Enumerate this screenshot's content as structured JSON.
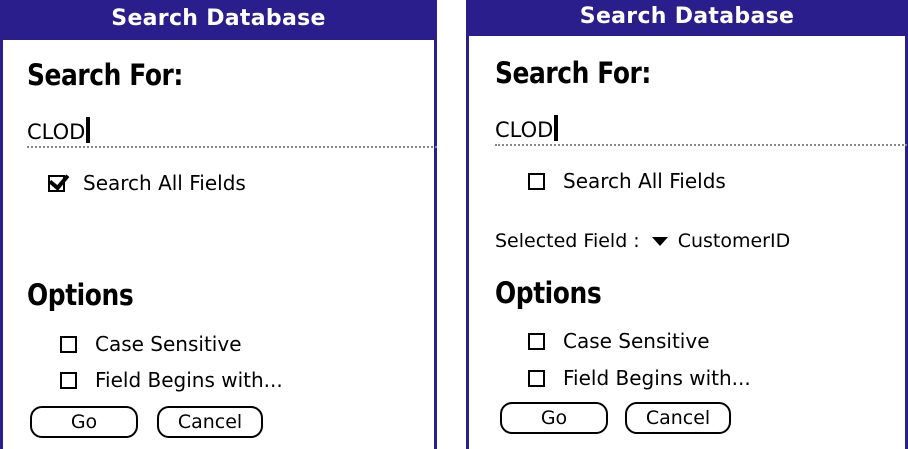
{
  "left_screen": {
    "title": "Search Database",
    "search_label": "Search For:",
    "search_value": "CLOD",
    "search_all_fields": {
      "label": "Search All Fields",
      "checked": true
    },
    "options_heading": "Options",
    "case_sensitive": {
      "label": "Case Sensitive",
      "checked": false
    },
    "field_begins": {
      "label": "Field Begins with...",
      "checked": false
    },
    "go_label": "Go",
    "cancel_label": "Cancel"
  },
  "right_screen": {
    "title": "Search Database",
    "search_label": "Search For:",
    "search_value": "CLOD",
    "search_all_fields": {
      "label": "Search All Fields",
      "checked": false
    },
    "selected_field_label": "Selected Field :",
    "selected_field_value": "CustomerID",
    "options_heading": "Options",
    "case_sensitive": {
      "label": "Case Sensitive",
      "checked": false
    },
    "field_begins": {
      "label": "Field Begins with...",
      "checked": false
    },
    "go_label": "Go",
    "cancel_label": "Cancel"
  },
  "colors": {
    "titlebar": "#2a1d8c",
    "background": "#ffffff"
  }
}
